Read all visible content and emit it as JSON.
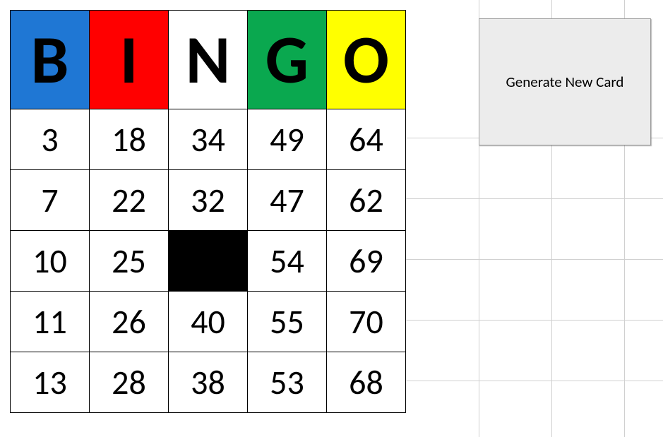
{
  "headers": {
    "b": {
      "label": "B",
      "color": "#1f77d4"
    },
    "i": {
      "label": "I",
      "color": "#ff0000"
    },
    "n": {
      "label": "N",
      "color": "#ffffff"
    },
    "g": {
      "label": "G",
      "color": "#0aa84f"
    },
    "o": {
      "label": "O",
      "color": "#ffff00"
    }
  },
  "rows": [
    {
      "b": "3",
      "i": "18",
      "n": "34",
      "g": "49",
      "o": "64"
    },
    {
      "b": "7",
      "i": "22",
      "n": "32",
      "g": "47",
      "o": "62"
    },
    {
      "b": "10",
      "i": "25",
      "n": "",
      "g": "54",
      "o": "69"
    },
    {
      "b": "11",
      "i": "26",
      "n": "40",
      "g": "55",
      "o": "70"
    },
    {
      "b": "13",
      "i": "28",
      "n": "38",
      "g": "53",
      "o": "68"
    }
  ],
  "button": {
    "label": "Generate New Card"
  }
}
